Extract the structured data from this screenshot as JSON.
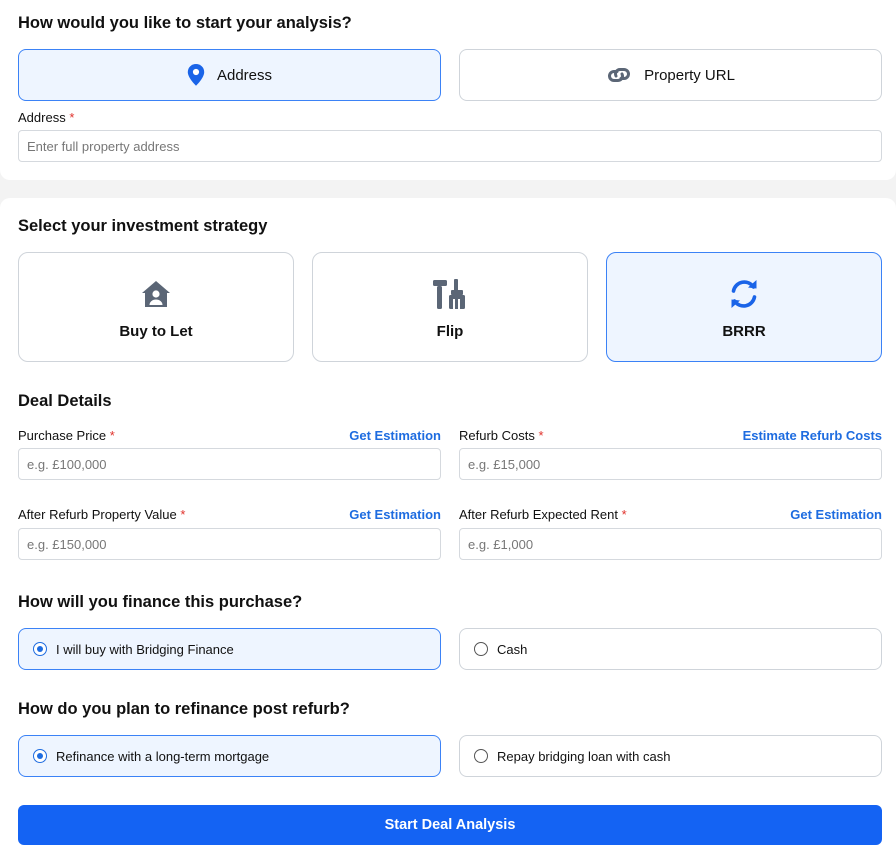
{
  "start": {
    "heading": "How would you like to start your analysis?",
    "options": [
      {
        "label": "Address",
        "icon": "map-pin-icon",
        "selected": true
      },
      {
        "label": "Property URL",
        "icon": "link-icon",
        "selected": false
      }
    ],
    "address_label": "Address",
    "required_mark": "*",
    "address_placeholder": "Enter full property address"
  },
  "strategy": {
    "heading": "Select your investment strategy",
    "options": [
      {
        "label": "Buy to Let",
        "icon": "house-user-icon",
        "selected": false
      },
      {
        "label": "Flip",
        "icon": "hammer-brush-icon",
        "selected": false
      },
      {
        "label": "BRRR",
        "icon": "refresh-icon",
        "selected": true
      }
    ]
  },
  "deal": {
    "heading": "Deal Details",
    "fields": [
      {
        "label": "Purchase Price",
        "action": "Get Estimation",
        "placeholder": "e.g. £100,000"
      },
      {
        "label": "Refurb Costs",
        "action": "Estimate Refurb Costs",
        "placeholder": "e.g. £15,000"
      },
      {
        "label": "After Refurb Property Value",
        "action": "Get Estimation",
        "placeholder": "e.g. £150,000"
      },
      {
        "label": "After Refurb Expected Rent",
        "action": "Get Estimation",
        "placeholder": "e.g. £1,000"
      }
    ]
  },
  "finance": {
    "heading": "How will you finance this purchase?",
    "options": [
      {
        "label": "I will buy with Bridging Finance",
        "selected": true
      },
      {
        "label": "Cash",
        "selected": false
      }
    ]
  },
  "refinance": {
    "heading": "How do you plan to refinance post refurb?",
    "options": [
      {
        "label": "Refinance with a long-term mortgage",
        "selected": true
      },
      {
        "label": "Repay bridging loan with cash",
        "selected": false
      }
    ]
  },
  "submit_label": "Start Deal Analysis",
  "colors": {
    "accent": "#1463f3",
    "link": "#1e6ce0",
    "selected_bg": "#eef5ff",
    "required": "#e0312b",
    "icon_gray": "#5b6676"
  }
}
